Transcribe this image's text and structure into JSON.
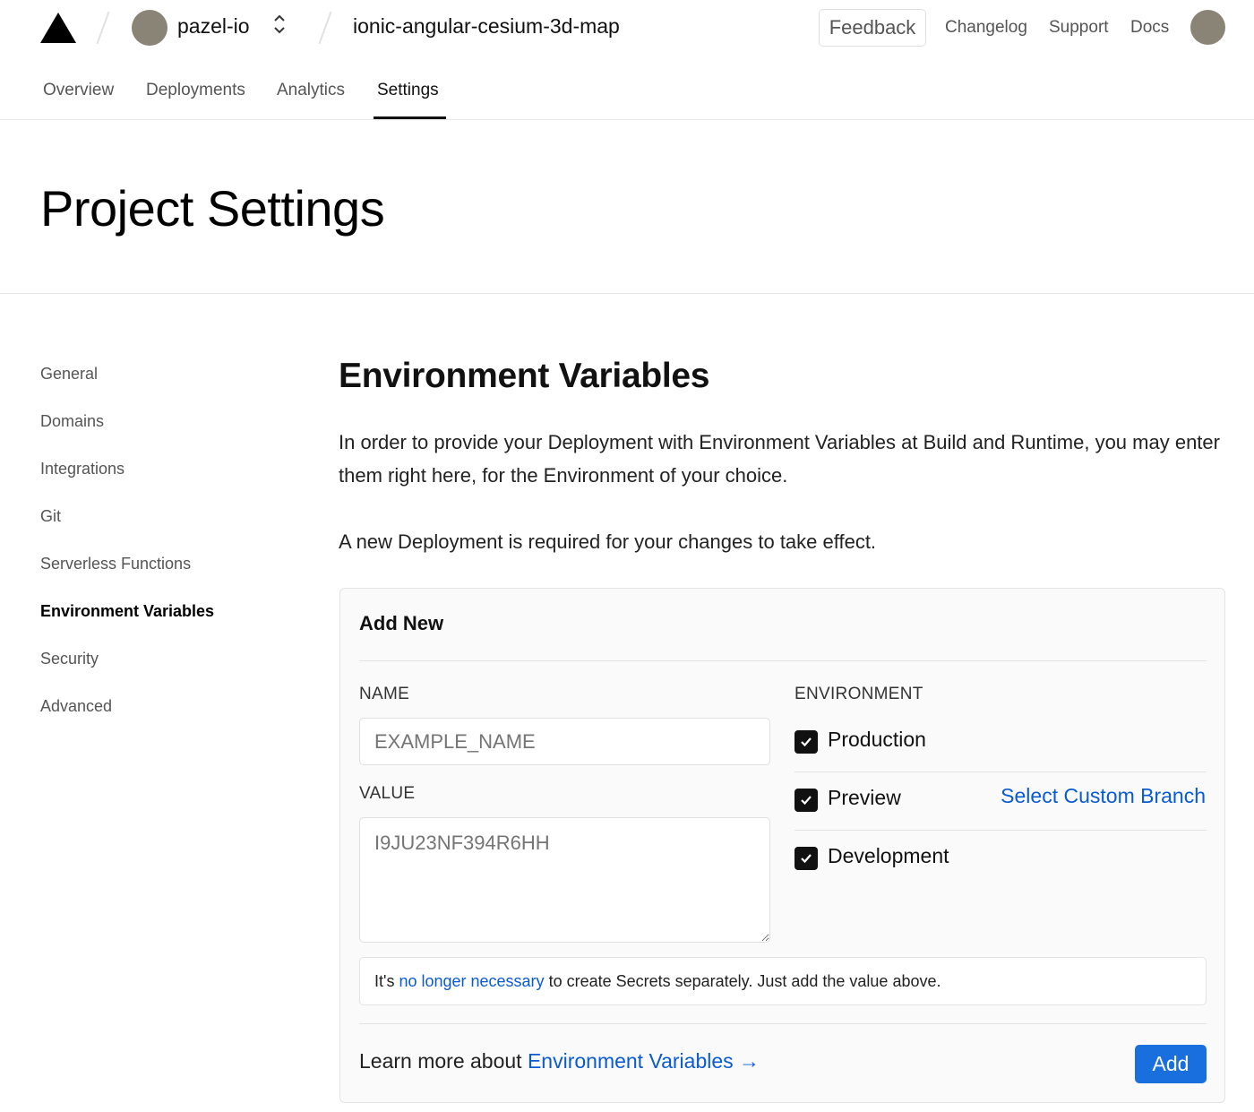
{
  "header": {
    "team_name": "pazel-io",
    "project_name": "ionic-angular-cesium-3d-map",
    "feedback_label": "Feedback",
    "links": [
      "Changelog",
      "Support",
      "Docs"
    ]
  },
  "nav": {
    "tabs": [
      "Overview",
      "Deployments",
      "Analytics",
      "Settings"
    ],
    "active_tab": "Settings"
  },
  "page": {
    "title": "Project Settings"
  },
  "sidebar": {
    "items": [
      "General",
      "Domains",
      "Integrations",
      "Git",
      "Serverless Functions",
      "Environment Variables",
      "Security",
      "Advanced"
    ],
    "active": "Environment Variables"
  },
  "main": {
    "section_title": "Environment Variables",
    "description_1": "In order to provide your Deployment with Environment Variables at Build and Runtime, you may enter them right here, for the Environment of your choice.",
    "description_2": "A new Deployment is required for your changes to take effect."
  },
  "card": {
    "title": "Add New",
    "name_label": "NAME",
    "name_placeholder": "EXAMPLE_NAME",
    "value_label": "VALUE",
    "value_placeholder": "I9JU23NF394R6HH",
    "environment_label": "ENVIRONMENT",
    "environments": [
      {
        "label": "Production",
        "checked": true
      },
      {
        "label": "Preview",
        "checked": true
      },
      {
        "label": "Development",
        "checked": true
      }
    ],
    "select_custom_branch": "Select Custom Branch",
    "note_prefix": "It's ",
    "note_link": "no longer necessary",
    "note_suffix": " to create Secrets separately. Just add the value above.",
    "learn_prefix": "Learn more about ",
    "learn_link": "Environment Variables →",
    "add_button": "Add"
  },
  "colors": {
    "accent_link": "#0a5bd3",
    "primary_button": "#1a6fde",
    "avatar": "#8a8476"
  }
}
